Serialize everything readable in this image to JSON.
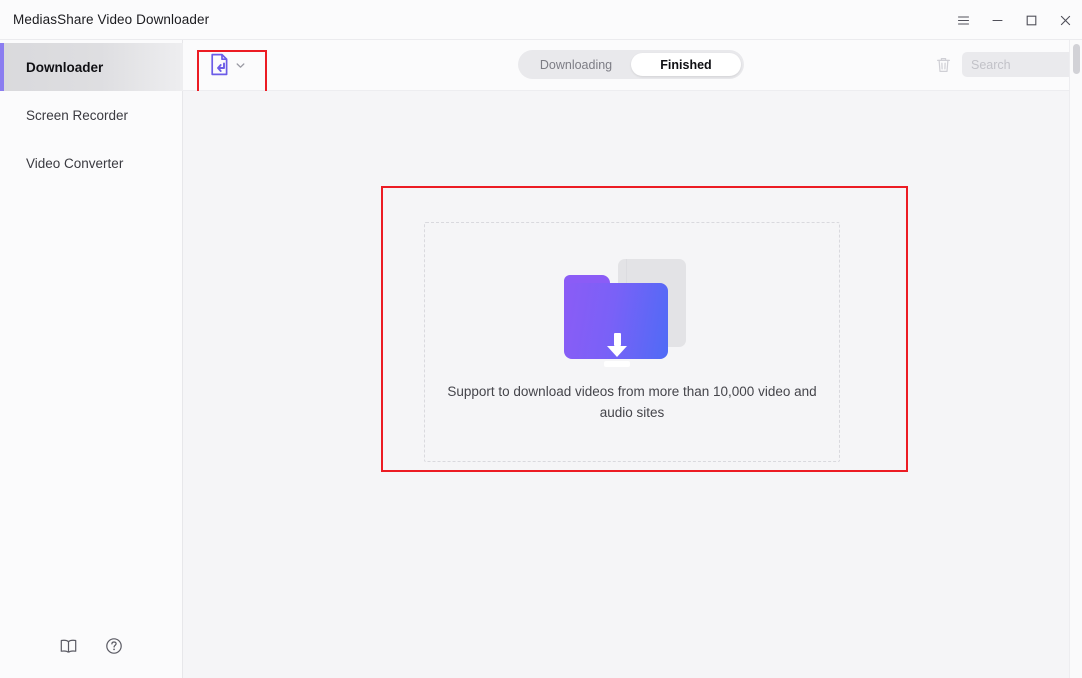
{
  "window": {
    "title": "MediasShare Video Downloader",
    "controls": [
      {
        "name": "menu-button",
        "icon": "hamburger-menu-icon",
        "label": "☰"
      },
      {
        "name": "minimize-button",
        "icon": "minimize-icon",
        "label": "—"
      },
      {
        "name": "maximize-button",
        "icon": "maximize-icon",
        "label": "□"
      },
      {
        "name": "close-button",
        "icon": "close-icon",
        "label": "✕"
      }
    ]
  },
  "sidebar": {
    "items": [
      {
        "label": "Downloader",
        "active": true
      },
      {
        "label": "Screen Recorder",
        "active": false
      },
      {
        "label": "Video Converter",
        "active": false
      }
    ],
    "bottom_icons": [
      {
        "name": "guide-book-icon",
        "title": "User Guide"
      },
      {
        "name": "help-question-icon",
        "title": "Help"
      }
    ]
  },
  "toolbar": {
    "paste_url_button": {
      "label": "Paste URL",
      "icon": "paste-url-document-icon",
      "dropdown_icon": "chevron-down-icon"
    },
    "tabs": [
      {
        "label": "Downloading",
        "active": false
      },
      {
        "label": "Finished",
        "active": true
      }
    ],
    "delete_button": {
      "label": "Delete",
      "icon": "trash-icon"
    },
    "search": {
      "value": "",
      "placeholder": "Search",
      "icon": "search-input"
    }
  },
  "content": {
    "empty_state": {
      "illustration": "download-folder-illustration",
      "message": "Support to download videos from more than 10,000 video and audio sites"
    }
  },
  "annotations": [
    {
      "name": "annotation-paste-url",
      "color": "#ec1c24"
    },
    {
      "name": "annotation-dropzone",
      "color": "#ec1c24"
    }
  ],
  "colors": {
    "accent_purple": "#8b7df0",
    "folder_gradient_start": "#8b5cf6",
    "folder_gradient_end": "#4f6bf6",
    "annotation_red": "#ec1c24",
    "sidebar_bg": "#fbfbfc",
    "content_bg": "#f5f5f7"
  }
}
